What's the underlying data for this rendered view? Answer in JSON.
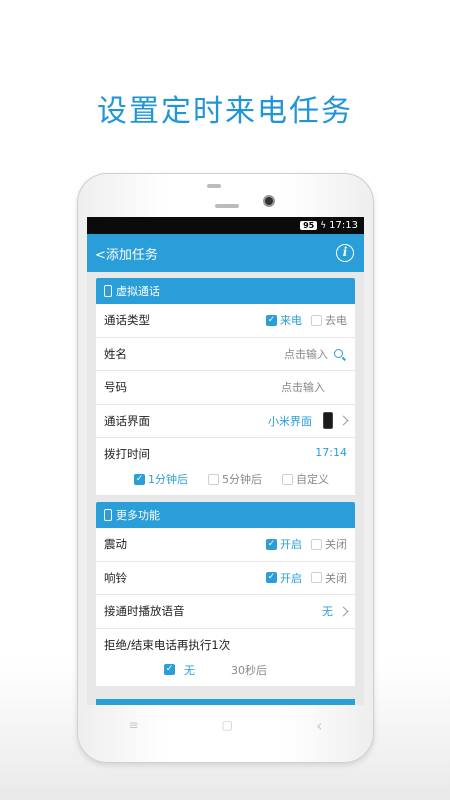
{
  "headline": "设置定时来电任务",
  "statusbar": {
    "battery": "95",
    "time": "17:13"
  },
  "appbar": {
    "back_label": "<添加任务",
    "info_icon": "info-icon"
  },
  "section1": {
    "title": "虚拟通话",
    "call_type": {
      "label": "通话类型",
      "opt1": "来电",
      "opt2": "去电"
    },
    "name": {
      "label": "姓名",
      "placeholder": "点击输入"
    },
    "number": {
      "label": "号码",
      "placeholder": "点击输入"
    },
    "interface": {
      "label": "通话界面",
      "value": "小米界面"
    },
    "dial_time": {
      "label": "拨打时间",
      "value": "17:14",
      "opt1": "1分钟后",
      "opt2": "5分钟后",
      "opt3": "自定义"
    }
  },
  "section2": {
    "title": "更多功能",
    "vibrate": {
      "label": "震动",
      "on": "开启",
      "off": "关闭"
    },
    "ring": {
      "label": "响铃",
      "on": "开启",
      "off": "关闭"
    },
    "voice": {
      "label": "接通时播放语音",
      "value": "无"
    },
    "retry": {
      "label": "拒绝/结束电话再执行1次",
      "opt1": "无",
      "opt2": "30秒后"
    }
  },
  "navbar": {
    "menu": "≡",
    "home": "▢",
    "back": "‹"
  },
  "colors": {
    "accent": "#2a9ed9",
    "headline": "#2196d6"
  }
}
